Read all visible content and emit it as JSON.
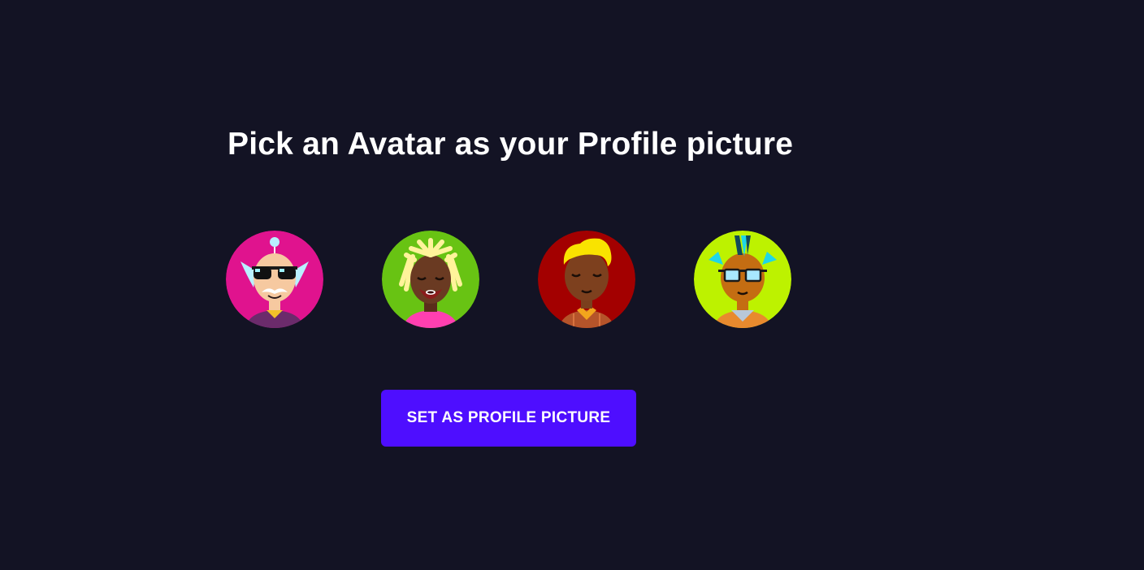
{
  "page": {
    "title": "Pick an Avatar as your Profile picture"
  },
  "avatars": [
    {
      "icon": "avatar-elder-sunglasses-icon",
      "bg": "#e0138e"
    },
    {
      "icon": "avatar-dreadlocks-icon",
      "bg": "#68c313"
    },
    {
      "icon": "avatar-blonde-quiff-icon",
      "bg": "#a30000"
    },
    {
      "icon": "avatar-mohawk-glasses-icon",
      "bg": "#bdf200"
    }
  ],
  "actions": {
    "set_profile_label": "SET AS PROFILE PICTURE"
  },
  "colors": {
    "background": "#131324",
    "accent": "#4e0eff",
    "text": "#ffffff"
  }
}
